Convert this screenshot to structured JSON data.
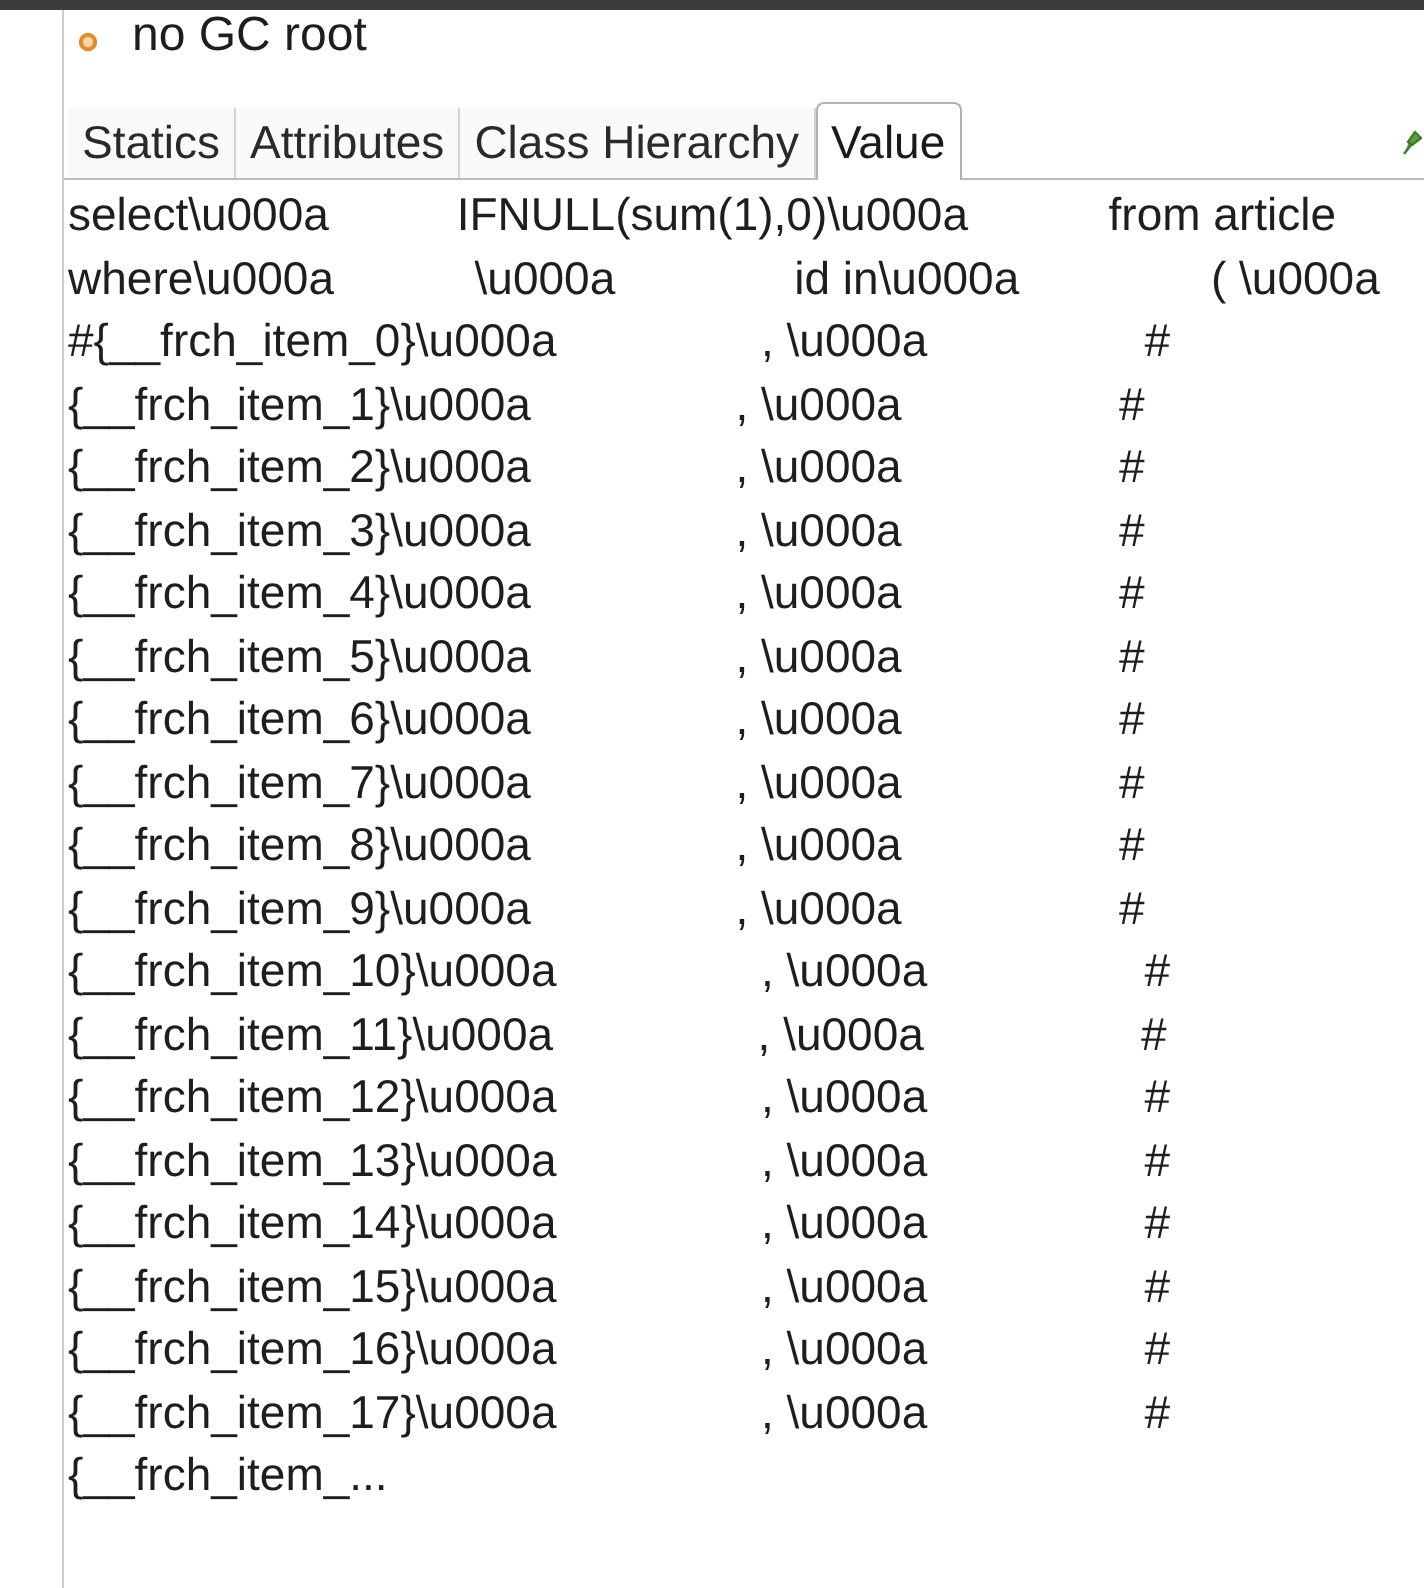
{
  "header": {
    "label": "no GC root"
  },
  "tabs": [
    {
      "label": "Statics",
      "selected": false
    },
    {
      "label": "Attributes",
      "selected": false
    },
    {
      "label": "Class Hierarchy",
      "selected": false
    },
    {
      "label": "Value",
      "selected": true
    }
  ],
  "value_lines": [
    "select\\u000a          IFNULL(sum(1),0)\\u000a           from article",
    "where\\u000a           \\u000a              id in\\u000a               ( \\u000a",
    "#{__frch_item_0}\\u000a                , \\u000a                 #",
    "{__frch_item_1}\\u000a                , \\u000a                 #",
    "{__frch_item_2}\\u000a                , \\u000a                 #",
    "{__frch_item_3}\\u000a                , \\u000a                 #",
    "{__frch_item_4}\\u000a                , \\u000a                 #",
    "{__frch_item_5}\\u000a                , \\u000a                 #",
    "{__frch_item_6}\\u000a                , \\u000a                 #",
    "{__frch_item_7}\\u000a                , \\u000a                 #",
    "{__frch_item_8}\\u000a                , \\u000a                 #",
    "{__frch_item_9}\\u000a                , \\u000a                 #",
    "{__frch_item_10}\\u000a                , \\u000a                 #",
    "{__frch_item_11}\\u000a                , \\u000a                 #",
    "{__frch_item_12}\\u000a                , \\u000a                 #",
    "{__frch_item_13}\\u000a                , \\u000a                 #",
    "{__frch_item_14}\\u000a                , \\u000a                 #",
    "{__frch_item_15}\\u000a                , \\u000a                 #",
    "{__frch_item_16}\\u000a                , \\u000a                 #",
    "{__frch_item_17}\\u000a                , \\u000a                 #",
    "{__frch_item_..."
  ]
}
